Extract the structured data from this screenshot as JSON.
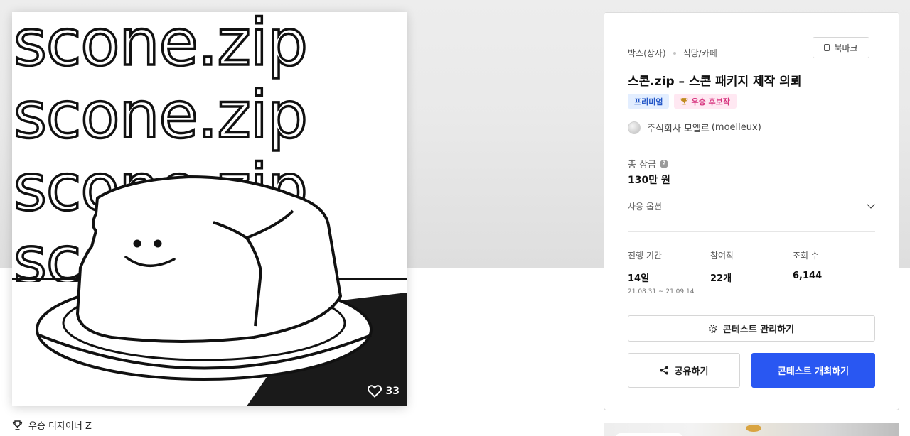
{
  "artwork": {
    "text_lines": [
      "scone.zip",
      "scone.zip",
      "scone.zip",
      "scone.zip"
    ],
    "likes": "33",
    "heart_icon": "heart-outline-icon"
  },
  "winner_label": "우승 디자이너 Z",
  "panel": {
    "categories": [
      "박스(상자)",
      "식당/카페"
    ],
    "bookmark_label": "북마크",
    "title": "스콘.zip – 스콘 패키지 제작 의뢰",
    "badges": {
      "premium": "프리미엄",
      "winner": "우승 후보작"
    },
    "owner": {
      "company": "주식회사 모엘르",
      "id": "(moelleux)"
    },
    "prize": {
      "label": "총 상금",
      "help": "?",
      "value": "130만 원"
    },
    "usage_label": "사용 옵션",
    "stats": {
      "period": {
        "label": "진행 기간",
        "value": "14일",
        "dates": "21.08.31 ~ 21.09.14"
      },
      "entries": {
        "label": "참여작",
        "value": "22개"
      },
      "views": {
        "label": "조회 수",
        "value": "6,144"
      }
    },
    "buttons": {
      "manage": "콘테스트 관리하기",
      "share": "공유하기",
      "host": "콘테스트 개최하기"
    }
  },
  "colors": {
    "primary": "#2957f2",
    "premium_badge": "#e3eeff",
    "winner_badge": "#ffe8f2"
  }
}
